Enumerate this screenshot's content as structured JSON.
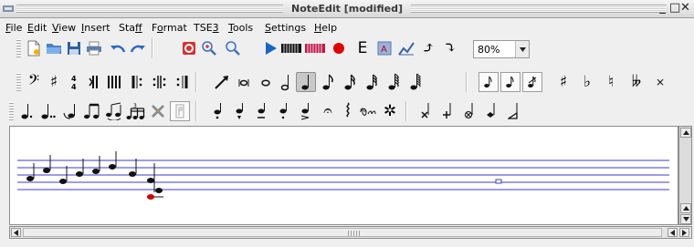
{
  "window": {
    "title": "NoteEdit [modified]",
    "controls": {
      "minimize": "_",
      "maximize": "□",
      "close": "✕"
    }
  },
  "menu": [
    {
      "label": "File",
      "mnemonic": "F"
    },
    {
      "label": "Edit",
      "mnemonic": "E"
    },
    {
      "label": "View",
      "mnemonic": "V"
    },
    {
      "label": "Insert",
      "mnemonic": "I"
    },
    {
      "label": "Staff",
      "mnemonic": "f"
    },
    {
      "label": "Format",
      "mnemonic": "o"
    },
    {
      "label": "TSE3",
      "mnemonic": "3"
    },
    {
      "label": "Tools",
      "mnemonic": "T"
    },
    {
      "label": "Settings",
      "mnemonic": "S"
    },
    {
      "label": "Help",
      "mnemonic": "H"
    }
  ],
  "toolbar1": {
    "zoom": "80%",
    "record_color": "#e00000",
    "play_color": "#1a64c8",
    "cursor_glyphs": {
      "up": "⤴",
      "down": "⤵"
    },
    "text_button": "E"
  },
  "toolbar2": {
    "clef_bass": "𝄢",
    "accidentals": {
      "sharp": "♯",
      "flat": "♭",
      "natural": "♮",
      "double_flat": "𝄫",
      "double_sharp": "×"
    }
  },
  "toolbar3": {
    "fermata": "𝄐",
    "pedal": "𝆮",
    "pedal_release": "✲",
    "tie_label": "𝄰"
  },
  "icons": [
    "new-file-icon",
    "open-file-icon",
    "save-icon",
    "print-icon",
    "undo-icon",
    "redo-icon",
    "zoom-in-icon",
    "zoom-out-icon",
    "play-icon",
    "keyboard-icon",
    "record-icon"
  ],
  "score": {
    "note_color": "#000000",
    "selected_note_color": "#d00000",
    "staff_line_color": "#3b3bd6"
  }
}
